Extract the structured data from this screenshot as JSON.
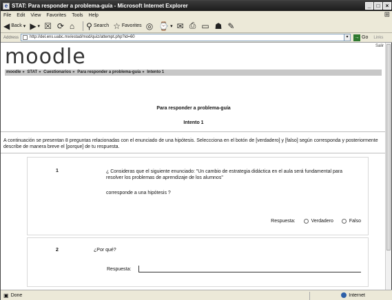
{
  "window": {
    "title": "STAT: Para responder a problema-guía - Microsoft Internet Explorer",
    "controls": [
      "_",
      "□",
      "×"
    ]
  },
  "menu": [
    "File",
    "Edit",
    "View",
    "Favorites",
    "Tools",
    "Help"
  ],
  "toolbar": {
    "back": "Back",
    "search": "Search",
    "favorites": "Favorites"
  },
  "address": {
    "label": "Address",
    "url": "http://del.ens.uabc.mx/estad/mod/quiz/attempt.php?id=60",
    "go": "Go",
    "links": "Links"
  },
  "page": {
    "salir": "Salir",
    "logo": "moodle",
    "breadcrumb": [
      "moodle",
      "STAT",
      "Cuestionarios",
      "Para responder a problema-guía",
      "Intento 1"
    ],
    "title": "Para responder a problema-guía",
    "attempt": "Intento 1",
    "intro": "A continuación se presentan 8 preguntas relacionadas con el enunciado de  una hipótesis. Seleccciona en el botón de [verdadero] y [falso] según corresponda y posteriormente describe de manera breve el [porque] de tu respuesta.",
    "q1": {
      "number": "1",
      "text": "¿ Consideras que el siguiente enunciado: \"Un cambio de estrategia didáctica en el aula será fundamental para resolver los problemas de aprendizaje de los alumnos\"",
      "subtext": "corresponde a una hipótesis ?",
      "answer_label": "Respuesta:",
      "option_true": "Verdadero",
      "option_false": "Falso"
    },
    "q2": {
      "number": "2",
      "text": "¿Por qué?",
      "answer_label": "Respuesta:"
    }
  },
  "status": {
    "text": "Done",
    "zone": "Internet"
  }
}
